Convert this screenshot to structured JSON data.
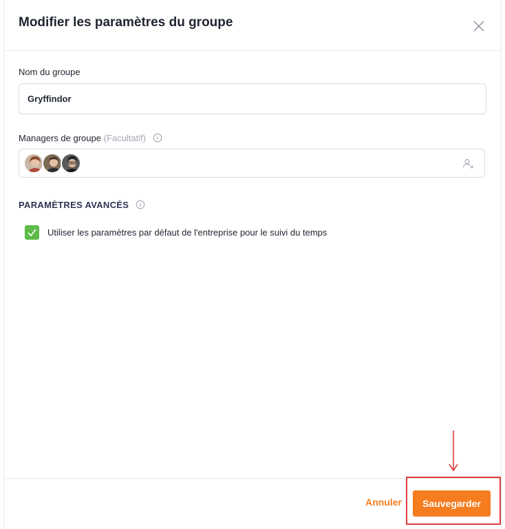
{
  "dialog": {
    "title": "Modifier les paramètres du groupe"
  },
  "group_name": {
    "label": "Nom du groupe",
    "value": "Gryffindor"
  },
  "managers": {
    "label": "Managers de groupe",
    "optional": "(Facultatif)",
    "avatars": [
      "avatar-1",
      "avatar-2",
      "avatar-3"
    ]
  },
  "advanced": {
    "title": "PARAMÈTRES AVANCÉS",
    "checkbox_label": "Utiliser les paramètres par défaut de l'entreprise pour le suivi du temps",
    "checkbox_checked": true
  },
  "footer": {
    "cancel_label": "Annuler",
    "save_label": "Sauvegarder"
  },
  "colors": {
    "accent": "#f57c1f",
    "check": "#5dbb4a",
    "highlight": "#e03b3b"
  }
}
